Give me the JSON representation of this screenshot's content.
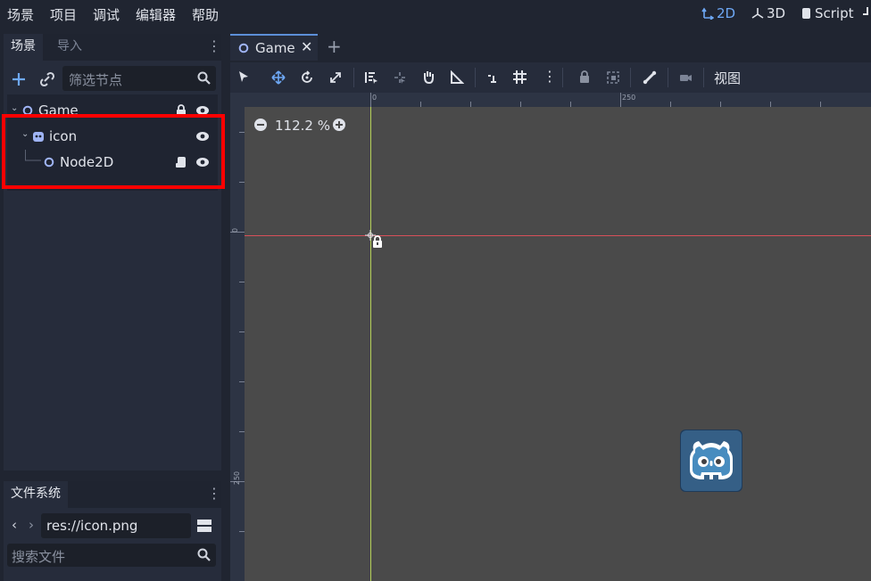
{
  "menu": {
    "items": [
      "场景",
      "项目",
      "调试",
      "编辑器",
      "帮助"
    ]
  },
  "modes": {
    "m2d": "2D",
    "m3d": "3D",
    "script": "Script"
  },
  "scene_dock": {
    "tab_scene": "场景",
    "tab_import": "导入",
    "filter_placeholder": "筛选节点",
    "tree": [
      {
        "label": "Game",
        "depth": 0
      },
      {
        "label": "icon",
        "depth": 1
      },
      {
        "label": "Node2D",
        "depth": 2
      }
    ]
  },
  "filesystem_dock": {
    "title": "文件系统",
    "path": "res://icon.png",
    "search_placeholder": "搜索文件"
  },
  "viewport": {
    "tab_label": "Game",
    "view_menu": "视图",
    "zoom": "112.2 %",
    "ruler_top": [
      "0",
      "250"
    ],
    "ruler_left": [
      "0",
      "250"
    ]
  },
  "colors": {
    "accent": "#6ea8f5",
    "highlight_box": "#ff0000",
    "canvas": "#4a4a4a"
  }
}
